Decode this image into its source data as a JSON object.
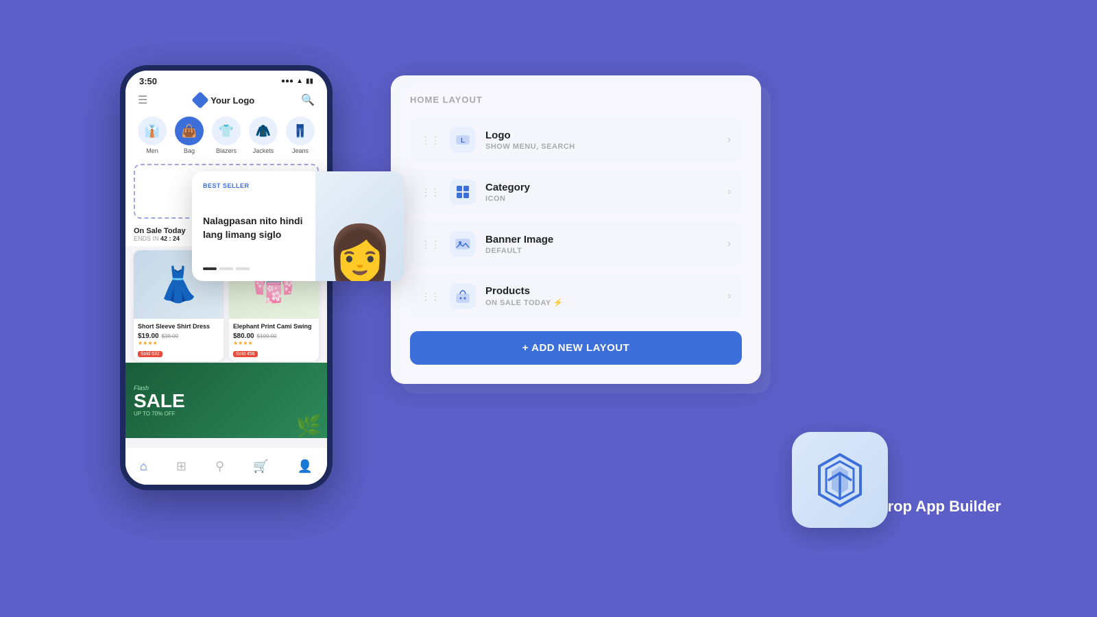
{
  "background_color": "#5b5fc7",
  "phone": {
    "status_bar": {
      "time": "3:50",
      "icons": [
        "wifi",
        "battery"
      ]
    },
    "logo_text": "Your Logo",
    "categories": [
      {
        "label": "Men",
        "icon": "👔",
        "active": false
      },
      {
        "label": "Bag",
        "icon": "👜",
        "active": true
      },
      {
        "label": "Blazers",
        "icon": "👕",
        "active": false
      },
      {
        "label": "Jackets",
        "icon": "🧥",
        "active": false
      },
      {
        "label": "Jeans",
        "icon": "👖",
        "active": false
      }
    ],
    "sale_section": {
      "title": "On Sale Today",
      "ends_in_label": "ENDS IN",
      "timer": "42 : 24"
    },
    "products": [
      {
        "name": "Short Sleeve Shirt Dress",
        "price": "$19.00",
        "old_price": "$38.00",
        "stars": "★★★★",
        "sold": "Sold 632"
      },
      {
        "name": "Elephant Print Cami Swing",
        "price": "$80.00",
        "old_price": "$100.00",
        "stars": "★★★★",
        "sold": "Sold 456"
      }
    ],
    "flash_sale": {
      "label": "Flash",
      "big_text": "SALE",
      "sub_text": "UP TO 70% OFF"
    },
    "bottom_nav_icons": [
      "🏠",
      "⊞",
      "🔍",
      "🛒",
      "👤"
    ]
  },
  "floating_card": {
    "badge": "BEST SELLER",
    "title": "Nalagpasan nito hindi lang limang siglo",
    "dots": [
      true,
      false,
      false
    ]
  },
  "right_panel": {
    "layout_title": "HOME LAYOUT",
    "items": [
      {
        "name": "Logo",
        "subtitle": "SHOW MENU, SEARCH",
        "icon_type": "logo"
      },
      {
        "name": "Category",
        "subtitle": "ICON",
        "icon_type": "category"
      },
      {
        "name": "Banner Image",
        "subtitle": "DEFAULT",
        "icon_type": "banner"
      },
      {
        "name": "Products",
        "subtitle": "ON SALE TODAY ⚡",
        "icon_type": "products"
      }
    ],
    "add_button_label": "+ ADD NEW LAYOUT"
  },
  "app_icon": {
    "label": "Drag & Drop App Builder"
  }
}
